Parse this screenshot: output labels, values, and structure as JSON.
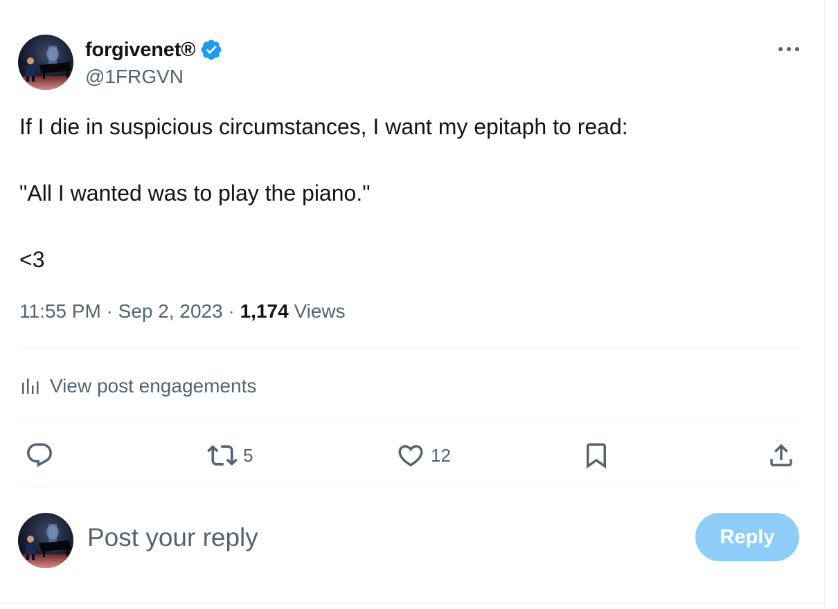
{
  "author": {
    "display_name": "forgivenet®",
    "handle": "@1FRGVN",
    "verified": true,
    "verified_color": "#1d9bf0"
  },
  "post": {
    "lines": [
      "If I die in suspicious circumstances, I want my epitaph to read:",
      "\"All I wanted was to play the piano.\"",
      "<3"
    ],
    "time": "11:55 PM",
    "separator": " · ",
    "date": "Sep 2, 2023",
    "views_count": "1,174",
    "views_label": " Views"
  },
  "engagements": {
    "label": "View post engagements",
    "icon": "bar-chart-icon"
  },
  "actions": {
    "reply": {
      "icon": "reply-icon"
    },
    "retweet": {
      "icon": "retweet-icon",
      "count": "5"
    },
    "like": {
      "icon": "heart-icon",
      "count": "12"
    },
    "bookmark": {
      "icon": "bookmark-icon"
    },
    "share": {
      "icon": "share-icon"
    }
  },
  "reply_box": {
    "placeholder": "Post your reply",
    "button_label": "Reply",
    "button_color": "#8ecdf8"
  },
  "colors": {
    "text_primary": "#0f1419",
    "text_secondary": "#536471",
    "divider": "#eff3f4"
  }
}
